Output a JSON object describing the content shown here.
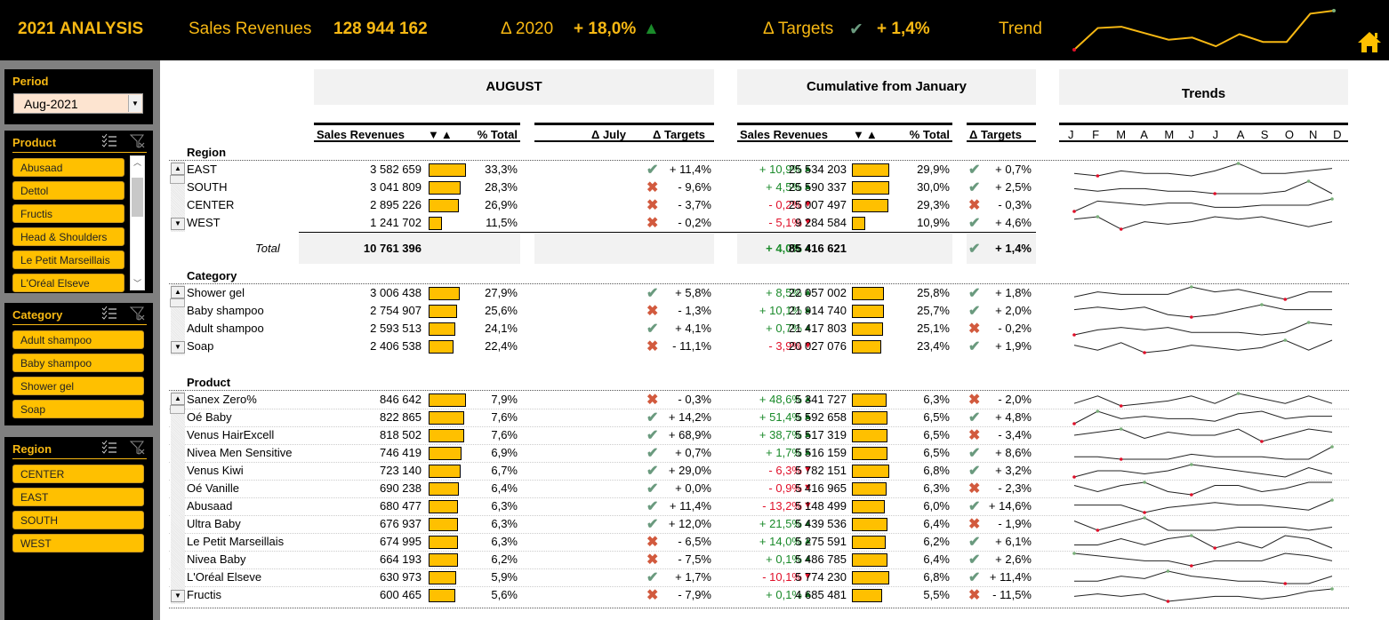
{
  "header": {
    "title": "2021 ANALYSIS",
    "sales_label": "Sales Revenues",
    "sales_value": "128 944 162",
    "delta_label": "Δ  2020",
    "delta_value": "+ 18,0%",
    "delta_arrow": "▲",
    "targets_label": "Δ Targets",
    "targets_check": "✔",
    "targets_value": "+ 1,4%",
    "trend_label": "Trend",
    "trend_series": [
      12,
      62,
      65,
      50,
      35,
      40,
      20,
      48,
      30,
      30,
      95,
      102
    ],
    "trend_color": "#f7b813"
  },
  "sidebar": {
    "period": {
      "label": "Period",
      "value": "Aug-2021"
    },
    "product": {
      "label": "Product",
      "items": [
        "Abusaad",
        "Dettol",
        "Fructis",
        "Head & Shoulders",
        "Le Petit Marseillais",
        "L'Oréal Elseve"
      ]
    },
    "category": {
      "label": "Category",
      "items": [
        "Adult shampoo",
        "Baby shampoo",
        "Shower gel",
        "Soap"
      ]
    },
    "region": {
      "label": "Region",
      "items": [
        "CENTER",
        "EAST",
        "SOUTH",
        "WEST"
      ]
    }
  },
  "bands": {
    "month": "AUGUST",
    "cumulative": "Cumulative from January",
    "trends": "Trends"
  },
  "columns": {
    "sales": "Sales Revenues",
    "sort": "▼▲",
    "pct": "% Total",
    "delta_month": "Δ July",
    "delta_targets": "Δ Targets",
    "months": [
      "J",
      "F",
      "M",
      "A",
      "M",
      "J",
      "J",
      "A",
      "S",
      "O",
      "N",
      "D"
    ]
  },
  "colors": {
    "accent": "#ffc000",
    "header_bg": "#000000",
    "positive": "#1a8a2a",
    "negative": "#e0102a",
    "check": "#6a9a7e",
    "cross": "#d25a3e"
  },
  "sections": {
    "region": {
      "title": "Region",
      "rows": [
        {
          "name": "EAST",
          "rev": "3 582 659",
          "share": 33.3,
          "pct": "33,3%",
          "dj": "+ 10,9%",
          "dir": "up",
          "t1": "ok",
          "dt1": "+ 11,4%",
          "crev": "25 534 203",
          "cshare": 29.9,
          "cpct": "29,9%",
          "t2": "ok",
          "dt2": "+ 0,7%",
          "spark": [
            5,
            4,
            6,
            5,
            5,
            4,
            6,
            9,
            5,
            5,
            6,
            7
          ]
        },
        {
          "name": "SOUTH",
          "rev": "3 041 809",
          "share": 28.3,
          "pct": "28,3%",
          "dj": "+ 4,5%",
          "dir": "up",
          "t1": "ko",
          "dt1": "- 9,6%",
          "crev": "25 590 337",
          "cshare": 30.0,
          "cpct": "30,0%",
          "t2": "ok",
          "dt2": "+ 2,5%",
          "spark": [
            6,
            5,
            6,
            6,
            5,
            5,
            4,
            4,
            4,
            5,
            9,
            4
          ]
        },
        {
          "name": "CENTER",
          "rev": "2 895 226",
          "share": 26.9,
          "pct": "26,9%",
          "dj": "- 0,2%",
          "dir": "down",
          "t1": "ko",
          "dt1": "- 3,7%",
          "crev": "25 007 497",
          "cshare": 29.3,
          "cpct": "29,3%",
          "t2": "ko",
          "dt2": "- 0,3%",
          "spark": [
            2,
            7,
            6,
            5,
            6,
            6,
            4,
            4,
            5,
            5,
            5,
            8
          ]
        },
        {
          "name": "WEST",
          "rev": "1 241 702",
          "share": 11.5,
          "pct": "11,5%",
          "dj": "- 5,1%",
          "dir": "down",
          "t1": "ko",
          "dt1": "- 0,2%",
          "crev": "9 284 584",
          "cshare": 10.9,
          "cpct": "10,9%",
          "t2": "ok",
          "dt2": "+ 4,6%",
          "spark": [
            6,
            7,
            2,
            5,
            4,
            5,
            7,
            6,
            7,
            5,
            3,
            5
          ]
        }
      ],
      "total": {
        "label": "Total",
        "rev": "10 761 396",
        "dj": "+ 4,0%",
        "crev": "85 416 621",
        "t2": "ok",
        "dt2": "+ 1,4%"
      }
    },
    "category": {
      "title": "Category",
      "rows": [
        {
          "name": "Shower gel",
          "rev": "3 006 438",
          "share": 27.9,
          "pct": "27,9%",
          "dj": "+ 8,5%",
          "dir": "up",
          "t1": "ok",
          "dt1": "+ 5,8%",
          "crev": "22 057 002",
          "cshare": 25.8,
          "cpct": "25,8%",
          "t2": "ok",
          "dt2": "+ 1,8%",
          "spark": [
            4,
            6,
            5,
            5,
            5,
            8,
            6,
            7,
            5,
            3,
            6,
            6
          ]
        },
        {
          "name": "Baby shampoo",
          "rev": "2 754 907",
          "share": 25.6,
          "pct": "25,6%",
          "dj": "+ 10,1%",
          "dir": "up",
          "t1": "ko",
          "dt1": "- 1,3%",
          "crev": "21 914 740",
          "cshare": 25.7,
          "cpct": "25,7%",
          "t2": "ok",
          "dt2": "+ 2,0%",
          "spark": [
            6,
            7,
            6,
            7,
            4,
            3,
            4,
            6,
            8,
            6,
            6,
            6
          ]
        },
        {
          "name": "Adult shampoo",
          "rev": "2 593 513",
          "share": 24.1,
          "pct": "24,1%",
          "dj": "+ 0,7%",
          "dir": "up",
          "t1": "ok",
          "dt1": "+ 4,1%",
          "crev": "21 417 803",
          "cshare": 25.1,
          "cpct": "25,1%",
          "t2": "ko",
          "dt2": "- 0,2%",
          "spark": [
            3,
            5,
            6,
            5,
            6,
            4,
            4,
            4,
            3,
            4,
            8,
            7
          ]
        },
        {
          "name": "Soap",
          "rev": "2 406 538",
          "share": 22.4,
          "pct": "22,4%",
          "dj": "- 3,9%",
          "dir": "down",
          "t1": "ko",
          "dt1": "- 11,1%",
          "crev": "20 027 076",
          "cshare": 23.4,
          "cpct": "23,4%",
          "t2": "ok",
          "dt2": "+ 1,9%",
          "spark": [
            5,
            3,
            6,
            2,
            3,
            5,
            4,
            3,
            4,
            7,
            3,
            7
          ]
        }
      ]
    },
    "product": {
      "title": "Product",
      "rows": [
        {
          "name": "Sanex Zero%",
          "rev": "846 642",
          "share": 7.9,
          "pct": "7,9%",
          "dj": "+ 48,6%",
          "dir": "up",
          "t1": "ko",
          "dt1": "- 0,3%",
          "crev": "5 341 727",
          "cshare": 6.3,
          "cpct": "6,3%",
          "t2": "ko",
          "dt2": "- 2,0%",
          "spark": [
            4,
            7,
            3,
            4,
            5,
            7,
            4,
            8,
            6,
            4,
            7,
            4
          ]
        },
        {
          "name": "Oé Baby",
          "rev": "822 865",
          "share": 7.6,
          "pct": "7,6%",
          "dj": "+ 51,4%",
          "dir": "up",
          "t1": "ok",
          "dt1": "+ 14,2%",
          "crev": "5 592 658",
          "cshare": 6.5,
          "cpct": "6,5%",
          "t2": "ok",
          "dt2": "+ 4,8%",
          "spark": [
            2,
            7,
            4,
            5,
            4,
            4,
            3,
            6,
            7,
            4,
            5,
            5
          ]
        },
        {
          "name": "Venus HairExcell",
          "rev": "818 502",
          "share": 7.6,
          "pct": "7,6%",
          "dj": "+ 38,7%",
          "dir": "up",
          "t1": "ok",
          "dt1": "+ 68,9%",
          "crev": "5 517 319",
          "cshare": 6.5,
          "cpct": "6,5%",
          "t2": "ko",
          "dt2": "- 3,4%",
          "spark": [
            5,
            6,
            7,
            4,
            6,
            5,
            5,
            7,
            3,
            5,
            7,
            6
          ]
        },
        {
          "name": "Nivea Men Sensitive",
          "rev": "746 419",
          "share": 6.9,
          "pct": "6,9%",
          "dj": "+ 1,7%",
          "dir": "up",
          "t1": "ok",
          "dt1": "+ 0,7%",
          "crev": "5 516 159",
          "cshare": 6.5,
          "cpct": "6,5%",
          "t2": "ok",
          "dt2": "+ 8,6%",
          "spark": [
            4,
            4,
            3,
            3,
            3,
            5,
            4,
            4,
            4,
            3,
            3,
            8
          ]
        },
        {
          "name": "Venus Kiwi",
          "rev": "723 140",
          "share": 6.7,
          "pct": "6,7%",
          "dj": "- 6,3%",
          "dir": "down",
          "t1": "ok",
          "dt1": "+ 29,0%",
          "crev": "5 782 151",
          "cshare": 6.8,
          "cpct": "6,8%",
          "t2": "ok",
          "dt2": "+ 3,2%",
          "spark": [
            3,
            5,
            5,
            4,
            5,
            7,
            6,
            5,
            4,
            3,
            6,
            4
          ]
        },
        {
          "name": "Oé Vanille",
          "rev": "690 238",
          "share": 6.4,
          "pct": "6,4%",
          "dj": "- 0,9%",
          "dir": "down",
          "t1": "ok",
          "dt1": "+ 0,0%",
          "crev": "5 416 965",
          "cshare": 6.3,
          "cpct": "6,3%",
          "t2": "ko",
          "dt2": "- 2,3%",
          "spark": [
            5,
            3,
            5,
            6,
            3,
            2,
            5,
            5,
            3,
            4,
            6,
            6
          ]
        },
        {
          "name": "Abusaad",
          "rev": "680 477",
          "share": 6.3,
          "pct": "6,3%",
          "dj": "- 13,2%",
          "dir": "down",
          "t1": "ok",
          "dt1": "+ 11,4%",
          "crev": "5 148 499",
          "cshare": 6.0,
          "cpct": "6,0%",
          "t2": "ok",
          "dt2": "+ 14,6%",
          "spark": [
            5,
            5,
            5,
            2,
            4,
            5,
            6,
            5,
            5,
            4,
            3,
            7
          ]
        },
        {
          "name": "Ultra Baby",
          "rev": "676 937",
          "share": 6.3,
          "pct": "6,3%",
          "dj": "+ 21,5%",
          "dir": "up",
          "t1": "ok",
          "dt1": "+ 12,0%",
          "crev": "5 439 536",
          "cshare": 6.4,
          "cpct": "6,4%",
          "t2": "ko",
          "dt2": "- 1,9%",
          "spark": [
            6,
            3,
            5,
            7,
            3,
            3,
            3,
            4,
            4,
            4,
            3,
            4
          ]
        },
        {
          "name": "Le Petit Marseillais",
          "rev": "674 995",
          "share": 6.3,
          "pct": "6,3%",
          "dj": "+ 14,0%",
          "dir": "up",
          "t1": "ko",
          "dt1": "- 6,5%",
          "crev": "5 275 591",
          "cshare": 6.2,
          "cpct": "6,2%",
          "t2": "ok",
          "dt2": "+ 6,1%",
          "spark": [
            4,
            4,
            6,
            4,
            6,
            7,
            3,
            5,
            3,
            7,
            6,
            3
          ]
        },
        {
          "name": "Nivea Baby",
          "rev": "664 193",
          "share": 6.2,
          "pct": "6,2%",
          "dj": "+ 0,1%",
          "dir": "up",
          "t1": "ko",
          "dt1": "- 7,5%",
          "crev": "5 486 785",
          "cshare": 6.4,
          "cpct": "6,4%",
          "t2": "ok",
          "dt2": "+ 2,6%",
          "spark": [
            7,
            6,
            5,
            4,
            4,
            2,
            4,
            4,
            4,
            7,
            6,
            4
          ]
        },
        {
          "name": "L'Oréal Elseve",
          "rev": "630 973",
          "share": 5.9,
          "pct": "5,9%",
          "dj": "- 10,1%",
          "dir": "down",
          "t1": "ok",
          "dt1": "+ 1,7%",
          "crev": "5 774 230",
          "cshare": 6.8,
          "cpct": "6,8%",
          "t2": "ok",
          "dt2": "+ 11,4%",
          "spark": [
            3,
            3,
            5,
            4,
            7,
            5,
            4,
            3,
            3,
            2,
            2,
            5
          ]
        },
        {
          "name": "Fructis",
          "rev": "600 465",
          "share": 5.6,
          "pct": "5,6%",
          "dj": "+ 0,1%",
          "dir": "up",
          "t1": "ko",
          "dt1": "- 7,9%",
          "crev": "4 685 481",
          "cshare": 5.5,
          "cpct": "5,5%",
          "t2": "ko",
          "dt2": "- 11,5%",
          "spark": [
            4,
            5,
            4,
            5,
            2,
            3,
            4,
            4,
            3,
            4,
            6,
            7
          ]
        }
      ]
    }
  }
}
